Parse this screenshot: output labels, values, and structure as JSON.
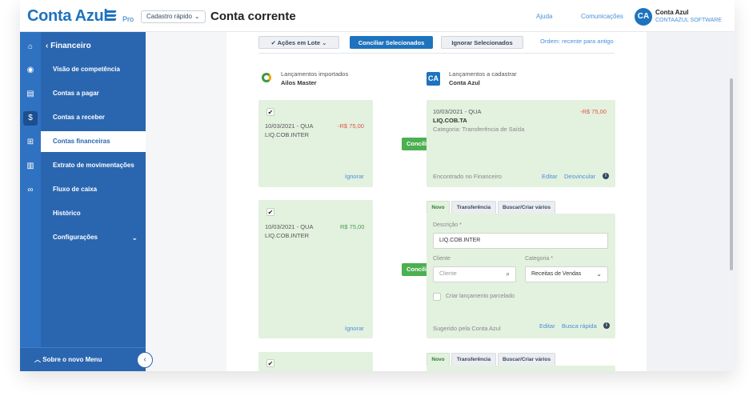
{
  "header": {
    "logo": "Conta Azul",
    "plan": "Pro",
    "quick_register": "Cadastro rápido",
    "page_title": "Conta corrente",
    "help": "Ajuda",
    "communications": "Comunicações",
    "avatar_initials": "CA",
    "user_name": "Conta Azul",
    "company": "CONTAAZUL SOFTWARE"
  },
  "sidebar": {
    "section_title": "Financeiro",
    "items": [
      {
        "label": "Visão de competência"
      },
      {
        "label": "Contas a pagar"
      },
      {
        "label": "Contas a receber"
      },
      {
        "label": "Contas financeiras"
      },
      {
        "label": "Extrato de movimentações"
      },
      {
        "label": "Fluxo de caixa"
      },
      {
        "label": "Histórico"
      },
      {
        "label": "Configurações"
      }
    ],
    "active_item": "Contas financeiras",
    "bottom": "Sobre o novo Menu",
    "rail_icons": [
      "home-icon",
      "eye-icon",
      "document-icon",
      "dollar-icon",
      "bank-icon",
      "chart-icon",
      "link-icon"
    ]
  },
  "toolbar": {
    "batch_actions": "Ações em Lote",
    "reconcile_selected": "Conciliar Selecionados",
    "ignore_selected": "Ignorar Selecionados",
    "order": "Ordem: recente para antigo"
  },
  "columns": {
    "imported_label": "Lançamentos importados",
    "imported_bank": "Ailos Master",
    "to_register_label": "Lançamentos a cadastrar",
    "to_register_source": "Conta Azul"
  },
  "rows": [
    {
      "imported": {
        "checked": "✔",
        "date": "10/03/2021 - QUA",
        "amount": "-R$ 75,00",
        "description": "LIQ.COB.INTER",
        "ignore": "Ignorar"
      },
      "reconcile": "Conciliar",
      "match": {
        "date": "10/03/2021 - QUA",
        "amount": "-R$ 75,00",
        "title": "LIQ.COB.TA",
        "category": "Categoria: Transferência de Saída",
        "found": "Encontrado no Financeiro",
        "edit": "Editar",
        "unlink": "Desvincular"
      }
    },
    {
      "imported": {
        "checked": "✔",
        "date": "10/03/2021 - QUA",
        "amount": "R$ 75,00",
        "description": "LIQ.COB.INTER",
        "ignore": "Ignorar"
      },
      "reconcile": "Conciliar",
      "tabs": [
        "Novo",
        "Transferência",
        "Buscar/Criar vários"
      ],
      "form": {
        "description_label": "Descrição *",
        "description_value": "LIQ.COB.INTER",
        "client_label": "Cliente",
        "client_placeholder": "Cliente",
        "category_label": "Categoria *",
        "category_value": "Receitas de Vendas",
        "installment": "Criar lançamento parcelado",
        "suggested": "Sugerido pela Conta Azul",
        "edit": "Editar",
        "quick_search": "Busca rápida"
      }
    },
    {
      "imported": {
        "checked": "✔"
      },
      "tabs": [
        "Novo",
        "Transferência",
        "Buscar/Criar vários"
      ]
    }
  ],
  "colors": {
    "brand": "#1e73be",
    "sidebar": "#2a66b0",
    "card": "#e3f1df",
    "conciliar": "#4caf50",
    "negative": "#e05548",
    "positive": "#4c9d4c"
  }
}
